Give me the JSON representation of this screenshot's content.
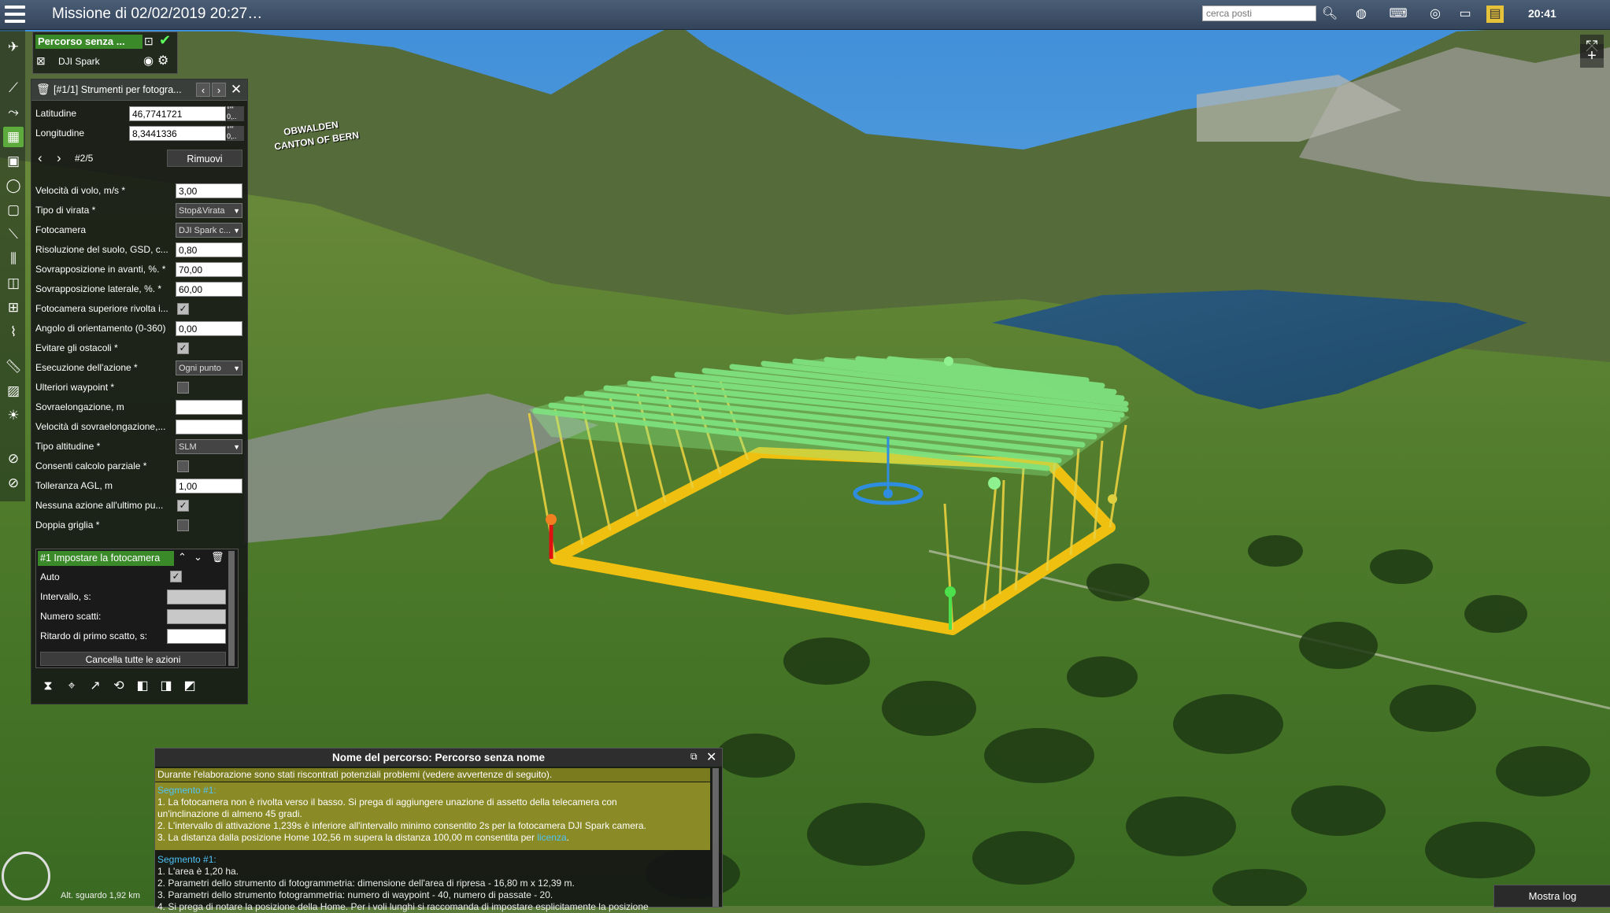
{
  "window": {
    "title": "Missione di 02/02/2019 20:27…",
    "clock": "20:41"
  },
  "search": {
    "placeholder": "cerca posti"
  },
  "route": {
    "name": "Percorso senza ...",
    "drone": "DJI Spark"
  },
  "panel": {
    "title": "[#1/1] Strumenti per fotogra...",
    "latitude_label": "Latitudine",
    "latitude_value": "46,7741721",
    "longitude_label": "Longitudine",
    "longitude_value": "8,3441336",
    "point_counter": "#2/5",
    "remove_label": "Rimuovi",
    "fields": [
      {
        "label": "Velocità di volo, m/s *",
        "value": "3,00"
      },
      {
        "label": "Tipo di virata *",
        "value": "Stop&Virata"
      },
      {
        "label": "Fotocamera",
        "value": "DJI Spark c..."
      },
      {
        "label": "Risoluzione del suolo, GSD, c...",
        "value": "0,80"
      },
      {
        "label": "Sovrapposizione in avanti, %. *",
        "value": "70,00"
      },
      {
        "label": "Sovrapposizione laterale, %. *",
        "value": "60,00"
      },
      {
        "label": "Fotocamera superiore rivolta i...",
        "value": ""
      },
      {
        "label": "Angolo di orientamento (0-360)",
        "value": "0,00"
      },
      {
        "label": "Evitare gli ostacoli *",
        "value": ""
      },
      {
        "label": "Esecuzione dell'azione *",
        "value": "Ogni punto"
      },
      {
        "label": "Ulteriori waypoint *",
        "value": ""
      },
      {
        "label": "Sovraelongazione, m",
        "value": ""
      },
      {
        "label": "Velocità di sovraelongazione,...",
        "value": ""
      },
      {
        "label": "Tipo altitudine *",
        "value": "SLM"
      },
      {
        "label": "Consenti calcolo parziale *",
        "value": ""
      },
      {
        "label": "Tolleranza AGL, m",
        "value": "1,00"
      },
      {
        "label": "Nessuna azione all'ultimo pu...",
        "value": ""
      },
      {
        "label": "Doppia griglia *",
        "value": ""
      }
    ],
    "action": {
      "title": "#1 Impostare la fotocamera",
      "auto_label": "Auto",
      "interval_label": "Intervallo, s:",
      "shots_label": "Numero scatti:",
      "delay_label": "Ritardo di primo scatto, s:",
      "delete_all_label": "Cancella tutte le azioni"
    }
  },
  "messages": {
    "header": "Nome del percorso: Percorso senza nome",
    "warning": "Durante l'elaborazione sono stati riscontrati potenziali problemi (vedere avvertenze di seguito).",
    "seg1_title": "Segmento #1:",
    "seg1_line1": "1. La fotocamera non è rivolta verso il basso. Si prega di aggiungere unazione di assetto della telecamera con",
    "seg1_line1b": "un'inclinazione di almeno 45 gradi.",
    "seg1_line2": "2. L'intervallo di attivazione 1,239s è inferiore all'intervallo minimo consentito 2s per la fotocamera DJI Spark camera.",
    "seg1_line3": "3. La distanza dalla posizione Home 102,56 m supera la distanza 100,00 m consentita per ",
    "seg1_link": "licenza",
    "seg2_title": "Segmento #1:",
    "seg2_line1": "1. L'area è 1,20 ha.",
    "seg2_line2": "2. Parametri dello strumento di fotogrammetria: dimensione dell'area di ripresa - 16,80 m x 12,39 m.",
    "seg2_line3": "3. Parametri dello strumento fotogrammetria: numero di waypoint - 40, numero di passate - 20.",
    "seg2_line4": "4. Si prega di notare la posizione della Home. Per i voli lunghi si raccomanda di impostare esplicitamente la posizione"
  },
  "map": {
    "label1": "OBWALDEN",
    "label2": "CANTON OF BERN",
    "altitude": "Alt. sguardo 1,92 km",
    "show_log": "Mostra log"
  },
  "colors": {
    "accent": "#5cab3c",
    "route_yellow": "#f0c010",
    "grid_green": "#7ee07e",
    "link": "#4fc3f7"
  }
}
